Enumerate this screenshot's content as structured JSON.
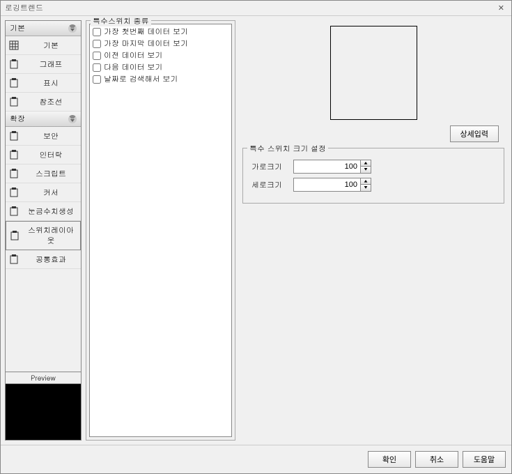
{
  "window": {
    "title": "로깅트렌드",
    "close": "✕"
  },
  "sidebar": {
    "group1": {
      "header": "기본",
      "items": [
        {
          "label": "기본"
        },
        {
          "label": "그래프"
        },
        {
          "label": "표시"
        },
        {
          "label": "참조선"
        }
      ]
    },
    "group2": {
      "header": "확장",
      "items": [
        {
          "label": "보안"
        },
        {
          "label": "인터락"
        },
        {
          "label": "스크립트"
        },
        {
          "label": "커서"
        },
        {
          "label": "눈금수치생성"
        },
        {
          "label": "스위치레이아웃"
        },
        {
          "label": "공통효과"
        }
      ]
    },
    "preview_label": "Preview"
  },
  "switch_types": {
    "legend": "특수스위치 종류",
    "items": [
      "가장 첫번째 데이터 보기",
      "가장 마지막 데이터 보기",
      "이전 데이터 보기",
      "다음 데이터 보기",
      "날짜로 검색해서 보기"
    ]
  },
  "detail_button": "상세입력",
  "size": {
    "legend": "특수 스위치 크기 설정",
    "width_label": "가로크기",
    "width_value": "100",
    "height_label": "세로크기",
    "height_value": "100"
  },
  "footer": {
    "ok": "확인",
    "cancel": "취소",
    "help": "도움말"
  }
}
